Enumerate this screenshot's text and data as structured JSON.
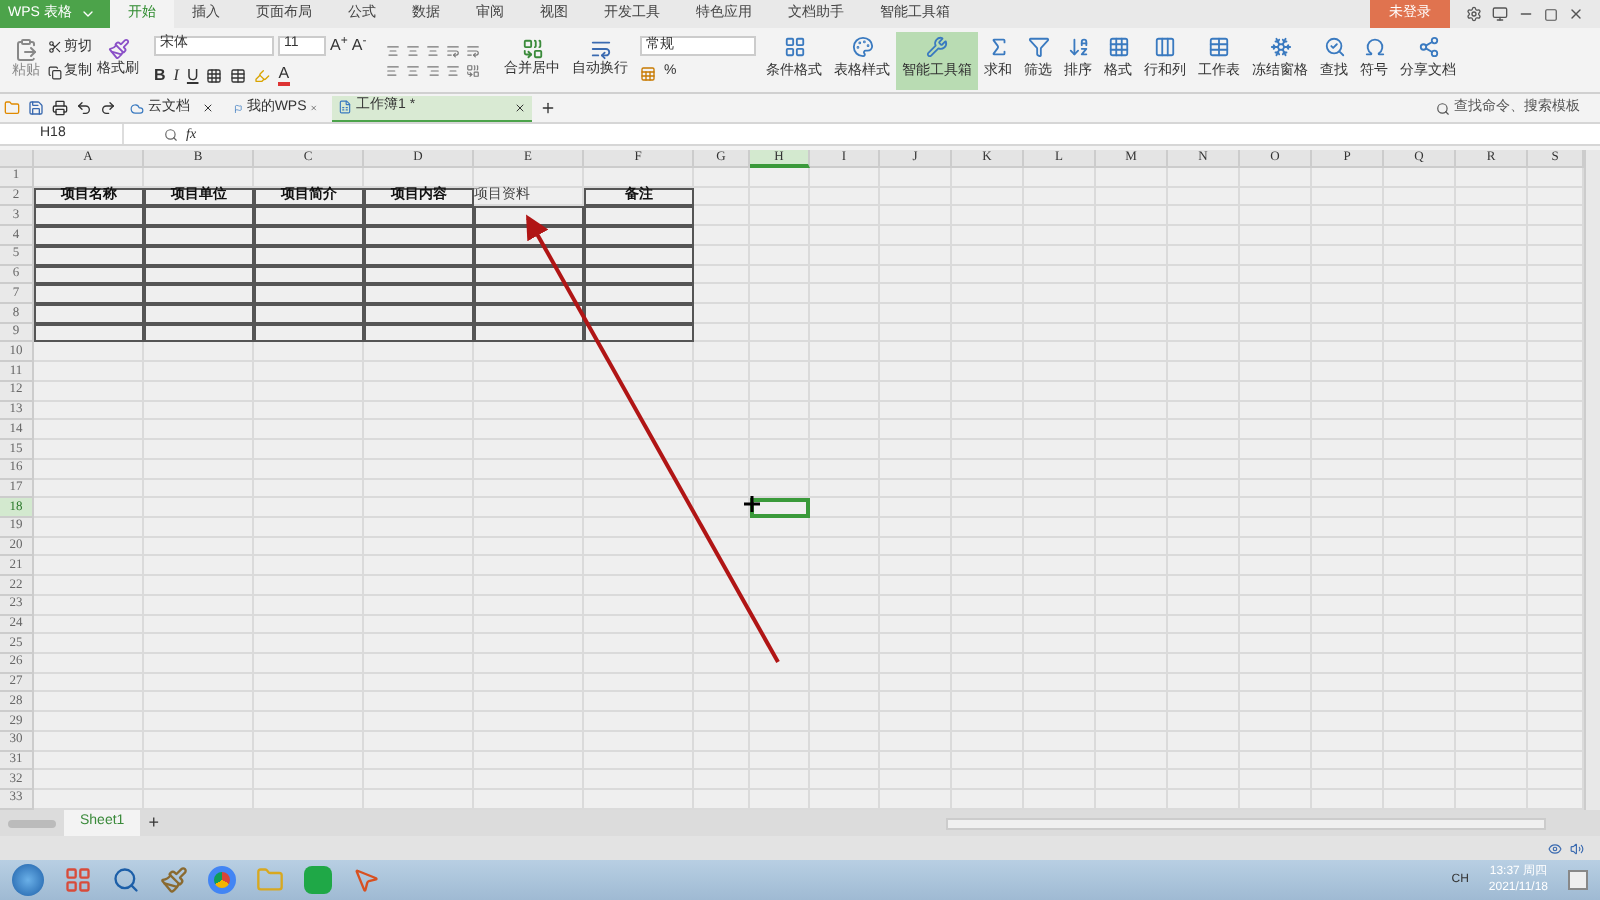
{
  "app_button": "WPS 表格",
  "menu_tabs": [
    {
      "label": "开始",
      "selected": true
    },
    {
      "label": "插入",
      "selected": false
    },
    {
      "label": "页面布局",
      "selected": false
    },
    {
      "label": "公式",
      "selected": false
    },
    {
      "label": "数据",
      "selected": false
    },
    {
      "label": "审阅",
      "selected": false
    },
    {
      "label": "视图",
      "selected": false
    },
    {
      "label": "开发工具",
      "selected": false
    },
    {
      "label": "特色应用",
      "selected": false
    },
    {
      "label": "文档助手",
      "selected": false
    },
    {
      "label": "智能工具箱",
      "selected": false
    }
  ],
  "login": "未登录",
  "ribbon": {
    "paste": "粘贴",
    "cut": "剪切",
    "copy": "复制",
    "format_painter": "格式刷",
    "font_name": "宋体",
    "font_size": "11",
    "grow_font": "A$^{+}$",
    "shrink_font": "A$^{-}$",
    "bold": "B",
    "italic": "I",
    "underline": "U",
    "font_color": "A",
    "merge": "合并居中",
    "wrap": "自动换行",
    "number_format": "常规",
    "percent": "%",
    "tools": [
      {
        "label": "条件格式",
        "selected": false
      },
      {
        "label": "表格样式",
        "selected": false
      },
      {
        "label": "智能工具箱",
        "selected": true
      },
      {
        "label": "求和",
        "selected": false
      },
      {
        "label": "筛选",
        "selected": false
      },
      {
        "label": "排序",
        "selected": false
      },
      {
        "label": "格式",
        "selected": false
      },
      {
        "label": "行和列",
        "selected": false
      },
      {
        "label": "工作表",
        "selected": false
      },
      {
        "label": "冻结窗格",
        "selected": false
      },
      {
        "label": "查找",
        "selected": false
      },
      {
        "label": "符号",
        "selected": false
      },
      {
        "label": "分享文档",
        "selected": false
      }
    ],
    "search_placeholder": "查找命令、搜索模板"
  },
  "doc_tabs": [
    {
      "label": "云文档",
      "selected": false
    },
    {
      "label": "我的WPS",
      "selected": false
    },
    {
      "label": "工作簿1 *",
      "selected": true
    }
  ],
  "name_box": "H18",
  "fx": "fx",
  "sheet": {
    "columns": [
      {
        "label": "A",
        "selected": false
      },
      {
        "label": "B",
        "selected": false
      },
      {
        "label": "C",
        "selected": false
      },
      {
        "label": "D",
        "selected": false
      },
      {
        "label": "E",
        "selected": false
      },
      {
        "label": "F",
        "selected": false
      },
      {
        "label": "G",
        "selected": false
      },
      {
        "label": "H",
        "selected": true
      },
      {
        "label": "I",
        "selected": false
      },
      {
        "label": "J",
        "selected": false
      },
      {
        "label": "K",
        "selected": false
      },
      {
        "label": "L",
        "selected": false
      },
      {
        "label": "M",
        "selected": false
      },
      {
        "label": "N",
        "selected": false
      },
      {
        "label": "O",
        "selected": false
      },
      {
        "label": "P",
        "selected": false
      },
      {
        "label": "Q",
        "selected": false
      },
      {
        "label": "R",
        "selected": false
      },
      {
        "label": "S",
        "selected": false
      }
    ],
    "rows": [
      {
        "label": "1",
        "kind": "plain",
        "selected": false
      },
      {
        "label": "2",
        "kind": "table-header",
        "selected": false,
        "cells": [
          {
            "text": "项目名称",
            "bold": true
          },
          {
            "text": "项目单位",
            "bold": true
          },
          {
            "text": "项目简介",
            "bold": true
          },
          {
            "text": "项目内容",
            "bold": true
          },
          {
            "text": "项目资料",
            "bold": false
          },
          {
            "text": "备注",
            "bold": true
          }
        ]
      },
      {
        "label": "3",
        "kind": "table-body",
        "selected": false
      },
      {
        "label": "4",
        "kind": "table-body",
        "selected": false
      },
      {
        "label": "5",
        "kind": "table-body",
        "selected": false
      },
      {
        "label": "6",
        "kind": "table-body",
        "selected": false
      },
      {
        "label": "7",
        "kind": "table-body",
        "selected": false
      },
      {
        "label": "8",
        "kind": "table-body",
        "selected": false
      },
      {
        "label": "9",
        "kind": "table-body",
        "selected": false
      },
      {
        "label": "10",
        "kind": "plain",
        "selected": false
      },
      {
        "label": "11",
        "kind": "plain",
        "selected": false
      },
      {
        "label": "12",
        "kind": "plain",
        "selected": false
      },
      {
        "label": "13",
        "kind": "plain",
        "selected": false
      },
      {
        "label": "14",
        "kind": "plain",
        "selected": false
      },
      {
        "label": "15",
        "kind": "plain",
        "selected": false
      },
      {
        "label": "16",
        "kind": "plain",
        "selected": false
      },
      {
        "label": "17",
        "kind": "plain",
        "selected": false
      },
      {
        "label": "18",
        "kind": "plain",
        "selected": true
      },
      {
        "label": "19",
        "kind": "plain",
        "selected": false
      },
      {
        "label": "20",
        "kind": "plain",
        "selected": false
      },
      {
        "label": "21",
        "kind": "plain",
        "selected": false
      },
      {
        "label": "22",
        "kind": "plain",
        "selected": false
      },
      {
        "label": "23",
        "kind": "plain",
        "selected": false
      },
      {
        "label": "24",
        "kind": "plain",
        "selected": false
      },
      {
        "label": "25",
        "kind": "plain",
        "selected": false
      },
      {
        "label": "26",
        "kind": "plain",
        "selected": false
      },
      {
        "label": "27",
        "kind": "plain",
        "selected": false
      },
      {
        "label": "28",
        "kind": "plain",
        "selected": false
      },
      {
        "label": "29",
        "kind": "plain",
        "selected": false
      },
      {
        "label": "30",
        "kind": "plain",
        "selected": false
      },
      {
        "label": "31",
        "kind": "plain",
        "selected": false
      },
      {
        "label": "32",
        "kind": "plain",
        "selected": false
      },
      {
        "label": "33",
        "kind": "plain",
        "selected": false
      }
    ]
  },
  "sheet_tabs": [
    {
      "label": "Sheet1",
      "selected": true
    }
  ],
  "add_sheet": "+",
  "taskbar": {
    "lang": "CH",
    "time": "13:37 周四",
    "date": "2021/11/18"
  }
}
